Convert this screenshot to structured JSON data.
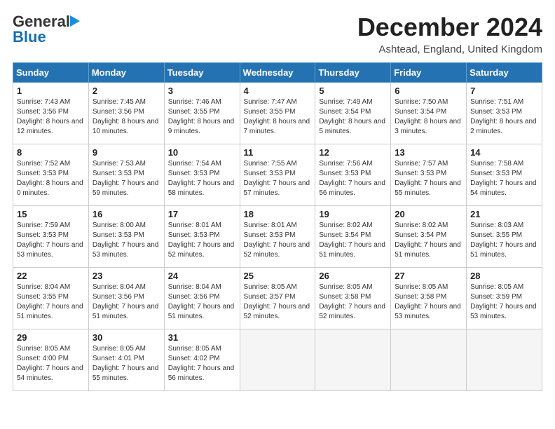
{
  "header": {
    "logo_line1": "General",
    "logo_line2": "Blue",
    "month": "December 2024",
    "location": "Ashtead, England, United Kingdom"
  },
  "days_of_week": [
    "Sunday",
    "Monday",
    "Tuesday",
    "Wednesday",
    "Thursday",
    "Friday",
    "Saturday"
  ],
  "weeks": [
    [
      {
        "day": "1",
        "sunrise": "7:43 AM",
        "sunset": "3:56 PM",
        "daylight": "8 hours and 12 minutes."
      },
      {
        "day": "2",
        "sunrise": "7:45 AM",
        "sunset": "3:56 PM",
        "daylight": "8 hours and 10 minutes."
      },
      {
        "day": "3",
        "sunrise": "7:46 AM",
        "sunset": "3:55 PM",
        "daylight": "8 hours and 9 minutes."
      },
      {
        "day": "4",
        "sunrise": "7:47 AM",
        "sunset": "3:55 PM",
        "daylight": "8 hours and 7 minutes."
      },
      {
        "day": "5",
        "sunrise": "7:49 AM",
        "sunset": "3:54 PM",
        "daylight": "8 hours and 5 minutes."
      },
      {
        "day": "6",
        "sunrise": "7:50 AM",
        "sunset": "3:54 PM",
        "daylight": "8 hours and 3 minutes."
      },
      {
        "day": "7",
        "sunrise": "7:51 AM",
        "sunset": "3:53 PM",
        "daylight": "8 hours and 2 minutes."
      }
    ],
    [
      {
        "day": "8",
        "sunrise": "7:52 AM",
        "sunset": "3:53 PM",
        "daylight": "8 hours and 0 minutes."
      },
      {
        "day": "9",
        "sunrise": "7:53 AM",
        "sunset": "3:53 PM",
        "daylight": "7 hours and 59 minutes."
      },
      {
        "day": "10",
        "sunrise": "7:54 AM",
        "sunset": "3:53 PM",
        "daylight": "7 hours and 58 minutes."
      },
      {
        "day": "11",
        "sunrise": "7:55 AM",
        "sunset": "3:53 PM",
        "daylight": "7 hours and 57 minutes."
      },
      {
        "day": "12",
        "sunrise": "7:56 AM",
        "sunset": "3:53 PM",
        "daylight": "7 hours and 56 minutes."
      },
      {
        "day": "13",
        "sunrise": "7:57 AM",
        "sunset": "3:53 PM",
        "daylight": "7 hours and 55 minutes."
      },
      {
        "day": "14",
        "sunrise": "7:58 AM",
        "sunset": "3:53 PM",
        "daylight": "7 hours and 54 minutes."
      }
    ],
    [
      {
        "day": "15",
        "sunrise": "7:59 AM",
        "sunset": "3:53 PM",
        "daylight": "7 hours and 53 minutes."
      },
      {
        "day": "16",
        "sunrise": "8:00 AM",
        "sunset": "3:53 PM",
        "daylight": "7 hours and 53 minutes."
      },
      {
        "day": "17",
        "sunrise": "8:01 AM",
        "sunset": "3:53 PM",
        "daylight": "7 hours and 52 minutes."
      },
      {
        "day": "18",
        "sunrise": "8:01 AM",
        "sunset": "3:53 PM",
        "daylight": "7 hours and 52 minutes."
      },
      {
        "day": "19",
        "sunrise": "8:02 AM",
        "sunset": "3:54 PM",
        "daylight": "7 hours and 51 minutes."
      },
      {
        "day": "20",
        "sunrise": "8:02 AM",
        "sunset": "3:54 PM",
        "daylight": "7 hours and 51 minutes."
      },
      {
        "day": "21",
        "sunrise": "8:03 AM",
        "sunset": "3:55 PM",
        "daylight": "7 hours and 51 minutes."
      }
    ],
    [
      {
        "day": "22",
        "sunrise": "8:04 AM",
        "sunset": "3:55 PM",
        "daylight": "7 hours and 51 minutes."
      },
      {
        "day": "23",
        "sunrise": "8:04 AM",
        "sunset": "3:56 PM",
        "daylight": "7 hours and 51 minutes."
      },
      {
        "day": "24",
        "sunrise": "8:04 AM",
        "sunset": "3:56 PM",
        "daylight": "7 hours and 51 minutes."
      },
      {
        "day": "25",
        "sunrise": "8:05 AM",
        "sunset": "3:57 PM",
        "daylight": "7 hours and 52 minutes."
      },
      {
        "day": "26",
        "sunrise": "8:05 AM",
        "sunset": "3:58 PM",
        "daylight": "7 hours and 52 minutes."
      },
      {
        "day": "27",
        "sunrise": "8:05 AM",
        "sunset": "3:58 PM",
        "daylight": "7 hours and 53 minutes."
      },
      {
        "day": "28",
        "sunrise": "8:05 AM",
        "sunset": "3:59 PM",
        "daylight": "7 hours and 53 minutes."
      }
    ],
    [
      {
        "day": "29",
        "sunrise": "8:05 AM",
        "sunset": "4:00 PM",
        "daylight": "7 hours and 54 minutes."
      },
      {
        "day": "30",
        "sunrise": "8:05 AM",
        "sunset": "4:01 PM",
        "daylight": "7 hours and 55 minutes."
      },
      {
        "day": "31",
        "sunrise": "8:05 AM",
        "sunset": "4:02 PM",
        "daylight": "7 hours and 56 minutes."
      },
      null,
      null,
      null,
      null
    ]
  ]
}
